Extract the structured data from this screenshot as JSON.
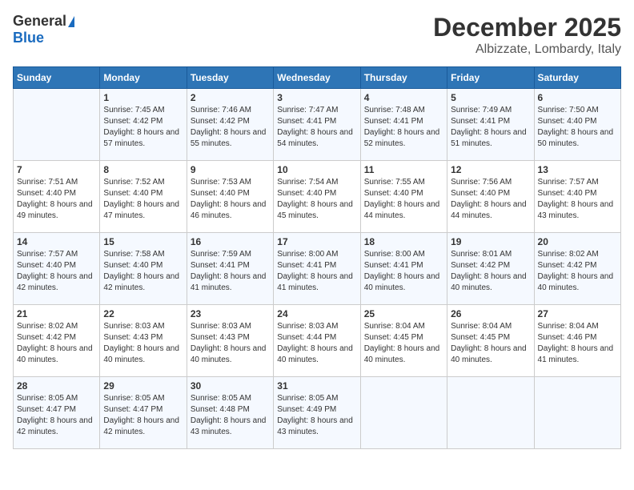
{
  "header": {
    "logo_general": "General",
    "logo_blue": "Blue",
    "month_title": "December 2025",
    "location": "Albizzate, Lombardy, Italy"
  },
  "days_of_week": [
    "Sunday",
    "Monday",
    "Tuesday",
    "Wednesday",
    "Thursday",
    "Friday",
    "Saturday"
  ],
  "weeks": [
    [
      {
        "day": "",
        "sunrise": "",
        "sunset": "",
        "daylight": ""
      },
      {
        "day": "1",
        "sunrise": "Sunrise: 7:45 AM",
        "sunset": "Sunset: 4:42 PM",
        "daylight": "Daylight: 8 hours and 57 minutes."
      },
      {
        "day": "2",
        "sunrise": "Sunrise: 7:46 AM",
        "sunset": "Sunset: 4:42 PM",
        "daylight": "Daylight: 8 hours and 55 minutes."
      },
      {
        "day": "3",
        "sunrise": "Sunrise: 7:47 AM",
        "sunset": "Sunset: 4:41 PM",
        "daylight": "Daylight: 8 hours and 54 minutes."
      },
      {
        "day": "4",
        "sunrise": "Sunrise: 7:48 AM",
        "sunset": "Sunset: 4:41 PM",
        "daylight": "Daylight: 8 hours and 52 minutes."
      },
      {
        "day": "5",
        "sunrise": "Sunrise: 7:49 AM",
        "sunset": "Sunset: 4:41 PM",
        "daylight": "Daylight: 8 hours and 51 minutes."
      },
      {
        "day": "6",
        "sunrise": "Sunrise: 7:50 AM",
        "sunset": "Sunset: 4:40 PM",
        "daylight": "Daylight: 8 hours and 50 minutes."
      }
    ],
    [
      {
        "day": "7",
        "sunrise": "Sunrise: 7:51 AM",
        "sunset": "Sunset: 4:40 PM",
        "daylight": "Daylight: 8 hours and 49 minutes."
      },
      {
        "day": "8",
        "sunrise": "Sunrise: 7:52 AM",
        "sunset": "Sunset: 4:40 PM",
        "daylight": "Daylight: 8 hours and 47 minutes."
      },
      {
        "day": "9",
        "sunrise": "Sunrise: 7:53 AM",
        "sunset": "Sunset: 4:40 PM",
        "daylight": "Daylight: 8 hours and 46 minutes."
      },
      {
        "day": "10",
        "sunrise": "Sunrise: 7:54 AM",
        "sunset": "Sunset: 4:40 PM",
        "daylight": "Daylight: 8 hours and 45 minutes."
      },
      {
        "day": "11",
        "sunrise": "Sunrise: 7:55 AM",
        "sunset": "Sunset: 4:40 PM",
        "daylight": "Daylight: 8 hours and 44 minutes."
      },
      {
        "day": "12",
        "sunrise": "Sunrise: 7:56 AM",
        "sunset": "Sunset: 4:40 PM",
        "daylight": "Daylight: 8 hours and 44 minutes."
      },
      {
        "day": "13",
        "sunrise": "Sunrise: 7:57 AM",
        "sunset": "Sunset: 4:40 PM",
        "daylight": "Daylight: 8 hours and 43 minutes."
      }
    ],
    [
      {
        "day": "14",
        "sunrise": "Sunrise: 7:57 AM",
        "sunset": "Sunset: 4:40 PM",
        "daylight": "Daylight: 8 hours and 42 minutes."
      },
      {
        "day": "15",
        "sunrise": "Sunrise: 7:58 AM",
        "sunset": "Sunset: 4:40 PM",
        "daylight": "Daylight: 8 hours and 42 minutes."
      },
      {
        "day": "16",
        "sunrise": "Sunrise: 7:59 AM",
        "sunset": "Sunset: 4:41 PM",
        "daylight": "Daylight: 8 hours and 41 minutes."
      },
      {
        "day": "17",
        "sunrise": "Sunrise: 8:00 AM",
        "sunset": "Sunset: 4:41 PM",
        "daylight": "Daylight: 8 hours and 41 minutes."
      },
      {
        "day": "18",
        "sunrise": "Sunrise: 8:00 AM",
        "sunset": "Sunset: 4:41 PM",
        "daylight": "Daylight: 8 hours and 40 minutes."
      },
      {
        "day": "19",
        "sunrise": "Sunrise: 8:01 AM",
        "sunset": "Sunset: 4:42 PM",
        "daylight": "Daylight: 8 hours and 40 minutes."
      },
      {
        "day": "20",
        "sunrise": "Sunrise: 8:02 AM",
        "sunset": "Sunset: 4:42 PM",
        "daylight": "Daylight: 8 hours and 40 minutes."
      }
    ],
    [
      {
        "day": "21",
        "sunrise": "Sunrise: 8:02 AM",
        "sunset": "Sunset: 4:42 PM",
        "daylight": "Daylight: 8 hours and 40 minutes."
      },
      {
        "day": "22",
        "sunrise": "Sunrise: 8:03 AM",
        "sunset": "Sunset: 4:43 PM",
        "daylight": "Daylight: 8 hours and 40 minutes."
      },
      {
        "day": "23",
        "sunrise": "Sunrise: 8:03 AM",
        "sunset": "Sunset: 4:43 PM",
        "daylight": "Daylight: 8 hours and 40 minutes."
      },
      {
        "day": "24",
        "sunrise": "Sunrise: 8:03 AM",
        "sunset": "Sunset: 4:44 PM",
        "daylight": "Daylight: 8 hours and 40 minutes."
      },
      {
        "day": "25",
        "sunrise": "Sunrise: 8:04 AM",
        "sunset": "Sunset: 4:45 PM",
        "daylight": "Daylight: 8 hours and 40 minutes."
      },
      {
        "day": "26",
        "sunrise": "Sunrise: 8:04 AM",
        "sunset": "Sunset: 4:45 PM",
        "daylight": "Daylight: 8 hours and 40 minutes."
      },
      {
        "day": "27",
        "sunrise": "Sunrise: 8:04 AM",
        "sunset": "Sunset: 4:46 PM",
        "daylight": "Daylight: 8 hours and 41 minutes."
      }
    ],
    [
      {
        "day": "28",
        "sunrise": "Sunrise: 8:05 AM",
        "sunset": "Sunset: 4:47 PM",
        "daylight": "Daylight: 8 hours and 42 minutes."
      },
      {
        "day": "29",
        "sunrise": "Sunrise: 8:05 AM",
        "sunset": "Sunset: 4:47 PM",
        "daylight": "Daylight: 8 hours and 42 minutes."
      },
      {
        "day": "30",
        "sunrise": "Sunrise: 8:05 AM",
        "sunset": "Sunset: 4:48 PM",
        "daylight": "Daylight: 8 hours and 43 minutes."
      },
      {
        "day": "31",
        "sunrise": "Sunrise: 8:05 AM",
        "sunset": "Sunset: 4:49 PM",
        "daylight": "Daylight: 8 hours and 43 minutes."
      },
      {
        "day": "",
        "sunrise": "",
        "sunset": "",
        "daylight": ""
      },
      {
        "day": "",
        "sunrise": "",
        "sunset": "",
        "daylight": ""
      },
      {
        "day": "",
        "sunrise": "",
        "sunset": "",
        "daylight": ""
      }
    ]
  ]
}
